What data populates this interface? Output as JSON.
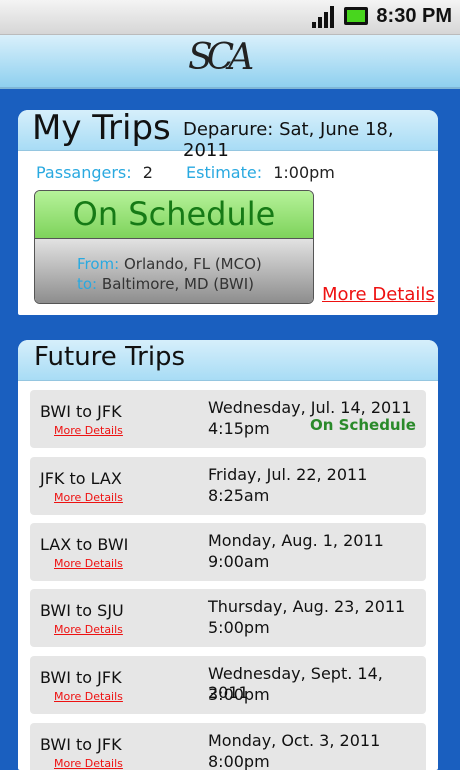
{
  "status_bar": {
    "time": "8:30 PM"
  },
  "header": {
    "logo": "SCA"
  },
  "my_trips": {
    "title": "My Trips",
    "departure": "Deparure: Sat, June 18, 2011",
    "passengers_label": "Passangers:",
    "passengers_value": "2",
    "estimate_label": "Estimate:",
    "estimate_value": "1:00pm",
    "status": "On Schedule",
    "from_label": "From:",
    "from_value": "Orlando, FL (MCO)",
    "to_label": "to:",
    "to_value": "Baltimore, MD (BWI)",
    "more_details": "More Details"
  },
  "future_trips": {
    "title": "Future Trips",
    "trips": [
      {
        "route": "BWI to JFK",
        "more": "More Details",
        "date": "Wednesday, Jul. 14, 2011",
        "time": "4:15pm",
        "status": "On Schedule"
      },
      {
        "route": "JFK to LAX",
        "more": "More Details",
        "date": "Friday, Jul. 22, 2011",
        "time": "8:25am",
        "status": ""
      },
      {
        "route": "LAX to BWI",
        "more": "More Details",
        "date": "Monday, Aug. 1, 2011",
        "time": "9:00am",
        "status": ""
      },
      {
        "route": "BWI to SJU",
        "more": "More Details",
        "date": "Thursday, Aug. 23, 2011",
        "time": "5:00pm",
        "status": ""
      },
      {
        "route": "BWI to JFK",
        "more": "More Details",
        "date": "Wednesday, Sept. 14, 2011",
        "time": "3:00pm",
        "status": ""
      },
      {
        "route": "BWI to JFK",
        "more": "More Details",
        "date": "Monday, Oct. 3, 2011",
        "time": "8:00pm",
        "status": ""
      }
    ]
  }
}
